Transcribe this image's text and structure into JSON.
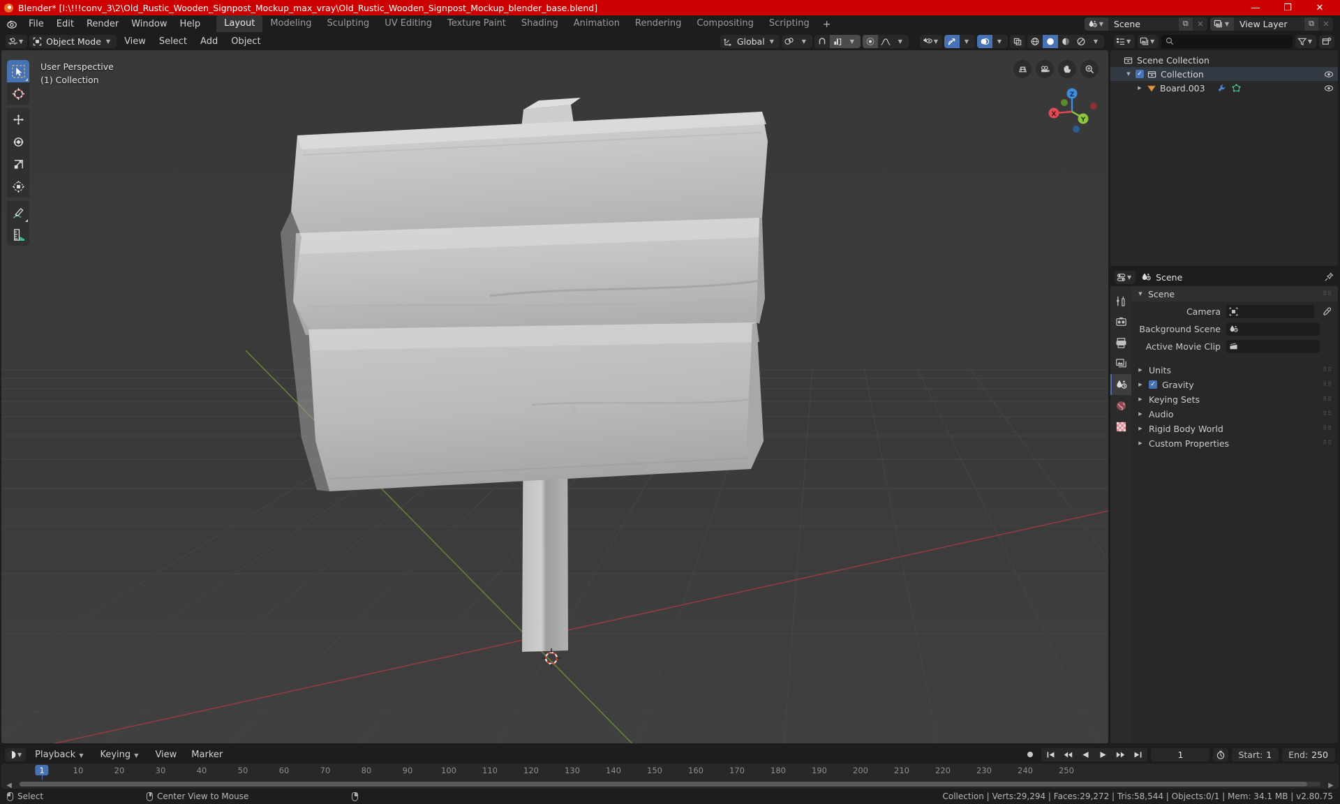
{
  "window": {
    "title": "Blender* [I:\\!!!conv_3\\2\\Old_Rustic_Wooden_Signpost_Mockup_max_vray\\Old_Rustic_Wooden_Signpost_Mockup_blender_base.blend]",
    "minimize": "—",
    "maximize": "❐",
    "close": "✕",
    "titlebar_color": "#cc0000"
  },
  "menus": [
    "File",
    "Edit",
    "Render",
    "Window",
    "Help"
  ],
  "workspaces": {
    "tabs": [
      "Layout",
      "Modeling",
      "Sculpting",
      "UV Editing",
      "Texture Paint",
      "Shading",
      "Animation",
      "Rendering",
      "Compositing",
      "Scripting"
    ],
    "active": "Layout",
    "add_label": "+"
  },
  "topbar_right": {
    "scene": {
      "label": "Scene",
      "new_btn": "⧉",
      "unlink_btn": "✕"
    },
    "view_layer": {
      "label": "View Layer",
      "new_btn": "⧉",
      "unlink_btn": "✕"
    }
  },
  "viewport": {
    "mode": "Object Mode",
    "menus": [
      "View",
      "Select",
      "Add",
      "Object"
    ],
    "transform_orientation": "Global",
    "overlay_line1": "User Perspective",
    "overlay_line2": "(1) Collection",
    "tools": [
      {
        "name": "tweak-select-box",
        "active": true
      },
      {
        "name": "cursor",
        "active": false
      },
      {
        "name": "move",
        "active": false
      },
      {
        "name": "rotate",
        "active": false
      },
      {
        "name": "scale",
        "active": false
      },
      {
        "name": "transform",
        "active": false
      },
      {
        "name": "annotate",
        "active": false
      },
      {
        "name": "measure",
        "active": false
      }
    ],
    "nav_buttons": [
      "toggle-camera-perspective",
      "camera-view",
      "pan-view",
      "zoom-view"
    ],
    "gizmo_axes": [
      {
        "label": "X",
        "color": "#e44a55"
      },
      {
        "label": "Y",
        "color": "#8ec63f"
      },
      {
        "label": "Z",
        "color": "#3c8ee0"
      }
    ],
    "background_color": "#393939",
    "object_color": "#c9c9c9"
  },
  "outliner": {
    "search_placeholder": "",
    "rows": [
      {
        "label": "Scene Collection",
        "indent": 0,
        "icon": "collection-icon",
        "has_disclosure": false,
        "has_checkbox": false,
        "has_eye": false,
        "selected": false
      },
      {
        "label": "Collection",
        "indent": 1,
        "icon": "collection-icon",
        "has_disclosure": true,
        "has_checkbox": true,
        "has_eye": true,
        "selected": true
      },
      {
        "label": "Board.003",
        "indent": 2,
        "icon": "mesh-data-icon",
        "has_disclosure": true,
        "has_checkbox": false,
        "has_eye": true,
        "selected": false
      }
    ]
  },
  "properties": {
    "editor_label": "Scene",
    "tabs": [
      "tool-icon",
      "render-icon",
      "output-icon",
      "view-layer-icon",
      "scene-icon",
      "world-icon",
      "texture-icon"
    ],
    "active_tab_index": 4,
    "panel_title": "Scene",
    "fields": [
      {
        "label": "Camera",
        "value": "",
        "icon": "camera-icon",
        "has_eyedropper": true
      },
      {
        "label": "Background Scene",
        "value": "",
        "icon": "scene-icon",
        "has_eyedropper": false
      },
      {
        "label": "Active Movie Clip",
        "value": "",
        "icon": "clip-icon",
        "has_eyedropper": false
      }
    ],
    "sections": [
      {
        "label": "Units",
        "checkbox": false
      },
      {
        "label": "Gravity",
        "checkbox": true
      },
      {
        "label": "Keying Sets",
        "checkbox": false
      },
      {
        "label": "Audio",
        "checkbox": false
      },
      {
        "label": "Rigid Body World",
        "checkbox": false
      },
      {
        "label": "Custom Properties",
        "checkbox": false
      }
    ]
  },
  "timeline": {
    "menus": [
      "Playback",
      "Keying",
      "View",
      "Marker"
    ],
    "current_frame": "1",
    "start_label": "Start:",
    "start_value": "1",
    "end_label": "End:",
    "end_value": "250",
    "ticks": [
      "10",
      "20",
      "30",
      "40",
      "50",
      "60",
      "70",
      "80",
      "90",
      "100",
      "110",
      "120",
      "130",
      "140",
      "150",
      "160",
      "170",
      "180",
      "190",
      "200",
      "210",
      "220",
      "230",
      "240",
      "250"
    ],
    "playhead_label": "1"
  },
  "statusbar": {
    "hints": [
      {
        "mouse": "left",
        "label": "Select"
      },
      {
        "mouse": "middle",
        "label": "Center View to Mouse"
      },
      {
        "mouse": "right",
        "label": ""
      }
    ],
    "stats": "Collection | Verts:29,294 | Faces:29,272 | Tris:58,544 | Objects:0/1 | Mem: 34.1 MB | v2.80.75"
  }
}
